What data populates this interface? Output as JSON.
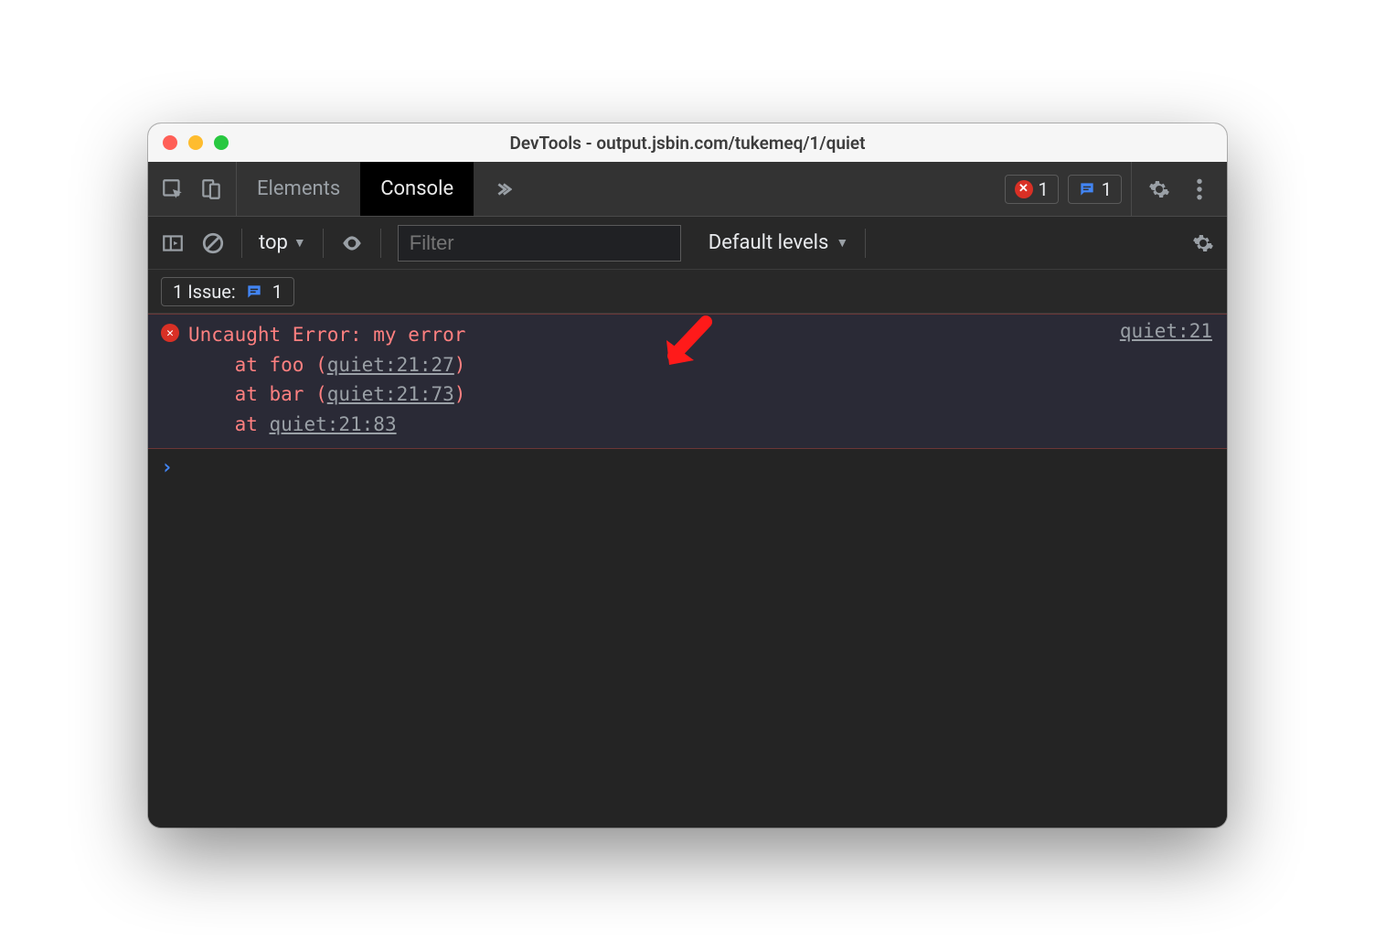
{
  "titlebar": {
    "title": "DevTools - output.jsbin.com/tukemeq/1/quiet"
  },
  "tabs": {
    "elements": "Elements",
    "console": "Console"
  },
  "badges": {
    "error_count": "1",
    "issue_count": "1"
  },
  "console_toolbar": {
    "context": "top",
    "filter_placeholder": "Filter",
    "levels": "Default levels"
  },
  "issues": {
    "label": "1 Issue:",
    "count": "1"
  },
  "error": {
    "message": "Uncaught Error: my error",
    "stack_at1_prefix": "    at foo (",
    "stack_at1_link": "quiet:21:27",
    "stack_at1_suffix": ")",
    "stack_at2_prefix": "    at bar (",
    "stack_at2_link": "quiet:21:73",
    "stack_at2_suffix": ")",
    "stack_at3_prefix": "    at ",
    "stack_at3_link": "quiet:21:83",
    "source_link": "quiet:21"
  },
  "prompt": {
    "symbol": "›"
  }
}
